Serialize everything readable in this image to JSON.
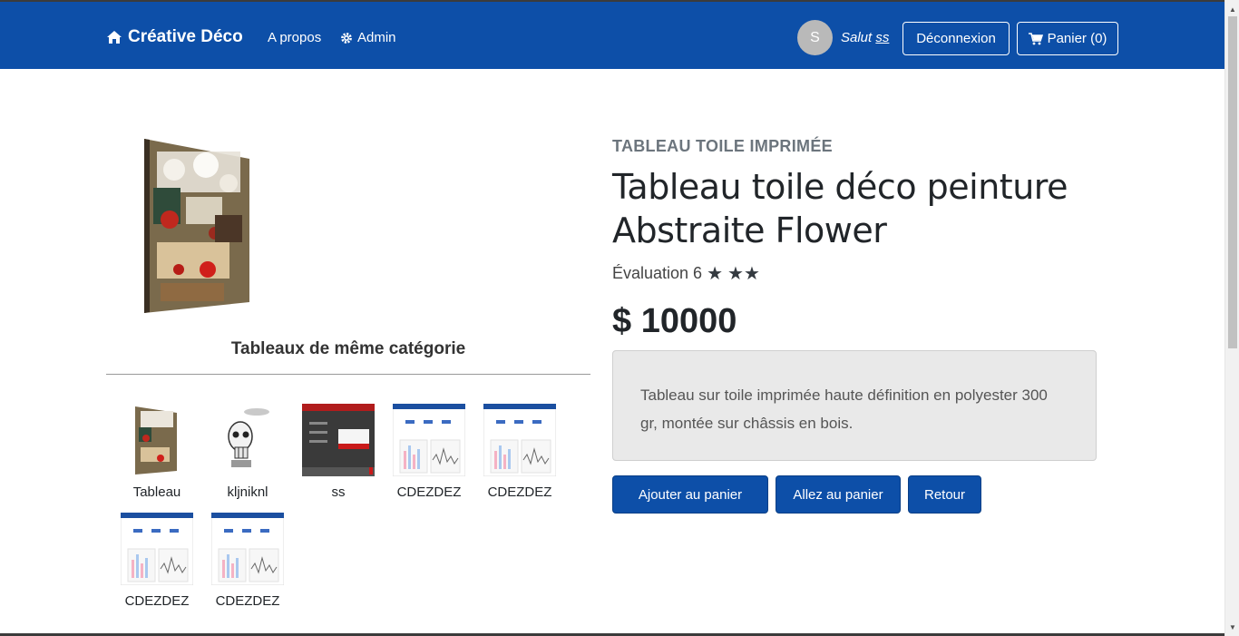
{
  "navbar": {
    "brand": "Créative Déco",
    "about": "A propos",
    "admin": "Admin",
    "avatar_initial": "S",
    "greeting_prefix": "Salut",
    "username": "ss",
    "logout": "Déconnexion",
    "cart": "Panier (0)",
    "bg_color": "#0d4fa8"
  },
  "related": {
    "title": "Tableaux de même catégorie",
    "items": [
      {
        "caption": "Tableau",
        "kind": "painting"
      },
      {
        "caption": "kljniknl",
        "kind": "skull"
      },
      {
        "caption": "ss",
        "kind": "screenshot-dark"
      },
      {
        "caption": "CDEZDEZ",
        "kind": "dashboard"
      },
      {
        "caption": "CDEZDEZ",
        "kind": "dashboard"
      },
      {
        "caption": "CDEZDEZ",
        "kind": "dashboard"
      },
      {
        "caption": "CDEZDEZ",
        "kind": "dashboard"
      }
    ]
  },
  "product": {
    "category": "TABLEAU TOILE IMPRIMÉE",
    "title": "Tableau toile déco peinture Abstraite Flower",
    "rating_label": "Évaluation 6",
    "stars": 3,
    "price": "$ 10000",
    "description": "Tableau sur toile imprimée haute définition en polyester 300 gr, montée sur châssis en bois."
  },
  "actions": {
    "add_to_cart": "Ajouter au panier",
    "go_to_cart": "Allez au panier",
    "back": "Retour"
  }
}
